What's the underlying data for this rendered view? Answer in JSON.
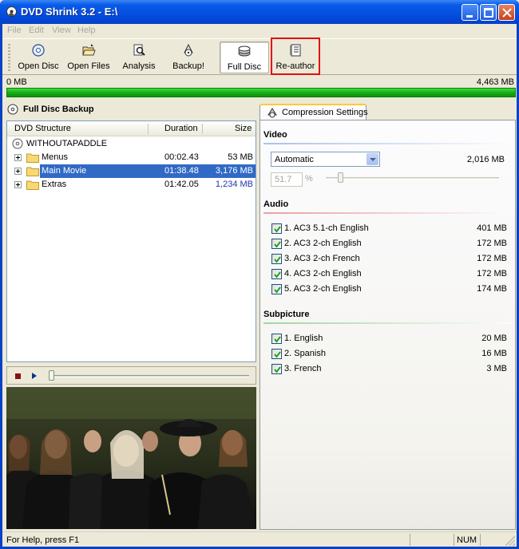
{
  "window": {
    "title": "DVD Shrink 3.2 - E:\\"
  },
  "menu": [
    "File",
    "Edit",
    "View",
    "Help"
  ],
  "toolbar": {
    "open_disc": "Open Disc",
    "open_files": "Open Files",
    "analysis": "Analysis",
    "backup": "Backup!",
    "full_disc": "Full Disc",
    "re_author": "Re-author"
  },
  "progress": {
    "min_label": "0 MB",
    "max_label": "4,463 MB",
    "fill_fraction": 1.0
  },
  "left": {
    "section_title": "Full Disc Backup",
    "columns": [
      "DVD Structure",
      "Duration",
      "Size"
    ],
    "root": "WITHOUTAPADDLE",
    "rows": [
      {
        "name": "Menus",
        "duration": "00:02.43",
        "size": "53 MB"
      },
      {
        "name": "Main Movie",
        "duration": "01:38.48",
        "size": "3,176 MB"
      },
      {
        "name": "Extras",
        "duration": "01:42.05",
        "size": "1,234 MB"
      }
    ]
  },
  "player": {
    "seek_fraction": 0.0
  },
  "settings": {
    "tab_label": "Compression Settings",
    "video": {
      "title": "Video",
      "mode": "Automatic",
      "size": "2,016 MB",
      "percent": "51.7",
      "percent_sign": "%"
    },
    "audio": {
      "title": "Audio",
      "items": [
        {
          "label": "1. AC3 5.1-ch English",
          "size": "401 MB",
          "checked": true
        },
        {
          "label": "2. AC3 2-ch English",
          "size": "172 MB",
          "checked": true
        },
        {
          "label": "3. AC3 2-ch French",
          "size": "172 MB",
          "checked": true
        },
        {
          "label": "4. AC3 2-ch English",
          "size": "172 MB",
          "checked": true
        },
        {
          "label": "5. AC3 2-ch English",
          "size": "174 MB",
          "checked": true
        }
      ]
    },
    "subpicture": {
      "title": "Subpicture",
      "items": [
        {
          "label": "1. English",
          "size": "20 MB",
          "checked": true
        },
        {
          "label": "2. Spanish",
          "size": "16 MB",
          "checked": true
        },
        {
          "label": "3. French",
          "size": "3 MB",
          "checked": true
        }
      ]
    }
  },
  "status": {
    "help": "For Help, press F1",
    "num": "NUM"
  },
  "colors": {
    "titlebar": "#0550e0",
    "progress": "#1bb21b",
    "selection": "#316ac5",
    "highlight": "#e01010",
    "video_line": "#a8c4e6",
    "audio_line": "#e8a0a0",
    "subpicture_line": "#9fd69f"
  }
}
